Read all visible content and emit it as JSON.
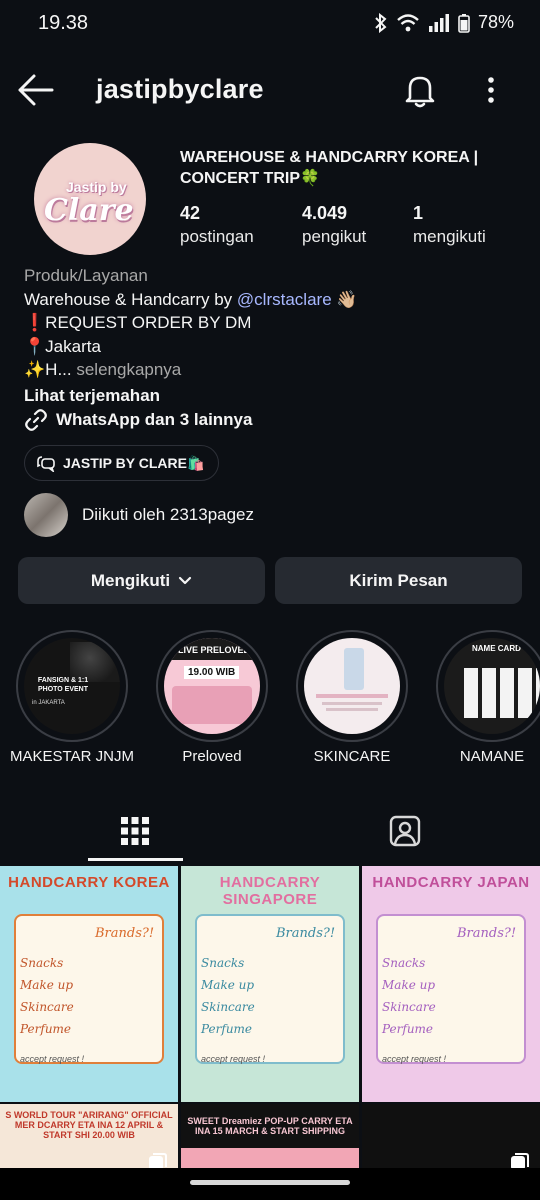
{
  "status_bar": {
    "time": "19.38",
    "battery": "78%"
  },
  "header": {
    "username": "jastipbyclare"
  },
  "profile": {
    "avatar_line1": "Jastip by",
    "avatar_line2": "Clare",
    "name": "WAREHOUSE & HANDCARRY KOREA | CONCERT TRIP🍀",
    "stats": [
      {
        "value": "42",
        "label": "postingan"
      },
      {
        "value": "4.049",
        "label": "pengikut"
      },
      {
        "value": "1",
        "label": "mengikuti"
      }
    ]
  },
  "bio": {
    "category": "Produk/Layanan",
    "line1_prefix": "Warehouse & Handcarry by ",
    "line1_mention": "@clrstaclare",
    "line1_suffix": " 👋🏼",
    "line2": "❗REQUEST ORDER BY DM",
    "line3": "📍Jakarta",
    "line4_prefix": "✨H...",
    "line4_more": " selengkapnya",
    "translate": "Lihat terjemahan",
    "links": "WhatsApp dan 3 lainnya",
    "chip": "JASTIP BY CLARE🛍️"
  },
  "followed_by": "Diikuti oleh 2313pagez",
  "actions": {
    "follow_label": "Mengikuti",
    "message_label": "Kirim Pesan"
  },
  "highlights": [
    {
      "label": "MAKESTAR JNJM",
      "cover_text": "FANSIGN & 1:1 PHOTO EVENT",
      "cover_sub": "in JAKARTA"
    },
    {
      "label": "Preloved",
      "cover_text": "LIVE PRELOVED",
      "cover_sub": "19.00 WIB"
    },
    {
      "label": "SKINCARE",
      "cover_text": "",
      "cover_sub": ""
    },
    {
      "label": "NAMANE",
      "cover_text": "NAME CARD",
      "cover_sub": ""
    }
  ],
  "posts": [
    {
      "title": "HANDCARRY KOREA",
      "book_title": "Brands?!",
      "categories": [
        "Snacks",
        "Make up",
        "Skincare",
        "Perfume"
      ],
      "accept": "accept request !",
      "color": "#f19a3e",
      "bg": "#a9e1ea"
    },
    {
      "title": "HANDCARRY SINGAPORE",
      "book_title": "Brands?!",
      "categories": [
        "Snacks",
        "Make up",
        "Skincare",
        "Perfume"
      ],
      "accept": "accept request !",
      "color": "#8fc9d6",
      "bg": "#c6e6d7"
    },
    {
      "title": "HANDCARRY JAPAN",
      "book_title": "Brands?!",
      "categories": [
        "Snacks",
        "Make up",
        "Skincare",
        "Perfume"
      ],
      "accept": "accept request !",
      "color": "#d39bd4",
      "bg": "#efc9e8"
    }
  ],
  "posts_row2": [
    {
      "caption": "S WORLD TOUR \"ARIRANG\" OFFICIAL MER DCARRY ETA INA 12 APRIL & START SHI 20.00 WIB",
      "bg": "#f5e7d8"
    },
    {
      "caption": "SWEET Dreamiez POP-UP CARRY ETA INA 15 MARCH & START SHIPPING",
      "bg": "#f2a6b5"
    },
    {
      "caption": "",
      "bg": "#101010"
    }
  ],
  "colors": {
    "background": "#0c0f14",
    "button": "#262a31",
    "mention": "#a8b8ff"
  }
}
